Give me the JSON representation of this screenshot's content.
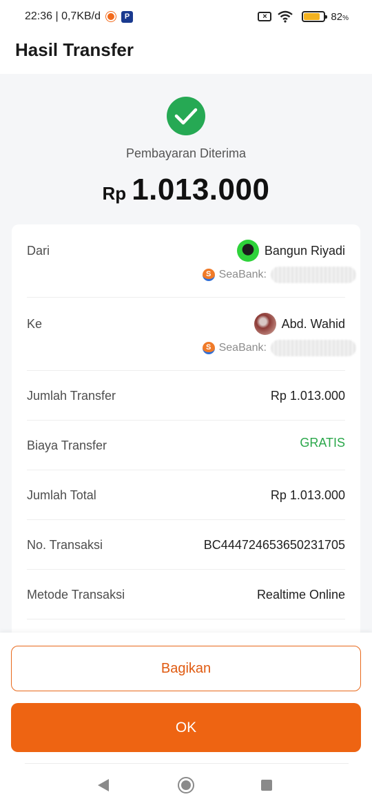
{
  "status_bar": {
    "time_speed": "22:36 | 0,7KB/d",
    "battery_percent": "82",
    "battery_unit": "%",
    "battery_level": 0.82,
    "icons": [
      "seabank-notification-icon",
      "paypal-notification-icon",
      "sim-none-icon",
      "wifi-icon",
      "battery-icon"
    ],
    "paypal_glyph": "P",
    "sim_glyph": "×"
  },
  "header": {
    "title": "Hasil Transfer"
  },
  "success": {
    "icon": "check-circle-icon",
    "icon_color": "#26a954",
    "message": "Pembayaran Diterima",
    "currency": "Rp",
    "amount": "1.013.000"
  },
  "details": {
    "from": {
      "label": "Dari",
      "name": "Bangun Riyadi",
      "bank": "SeaBank:",
      "bank_glyph": "S"
    },
    "to": {
      "label": "Ke",
      "name": "Abd. Wahid",
      "bank": "SeaBank:",
      "bank_glyph": "S"
    },
    "rows": [
      {
        "label": "Jumlah Transfer",
        "value": "Rp 1.013.000"
      },
      {
        "label": "Biaya Transfer",
        "value": "GRATIS"
      },
      {
        "label": "Jumlah Total",
        "value": "Rp 1.013.000"
      },
      {
        "label": "No. Transaksi",
        "value": "BC444724653650231705"
      },
      {
        "label": "Metode Transaksi",
        "value": "Realtime Online"
      }
    ]
  },
  "actions": {
    "share_label": "Bagikan",
    "ok_label": "OK"
  },
  "colors": {
    "accent": "#ee6412",
    "success": "#26a954",
    "free_text": "#2aa74a"
  }
}
